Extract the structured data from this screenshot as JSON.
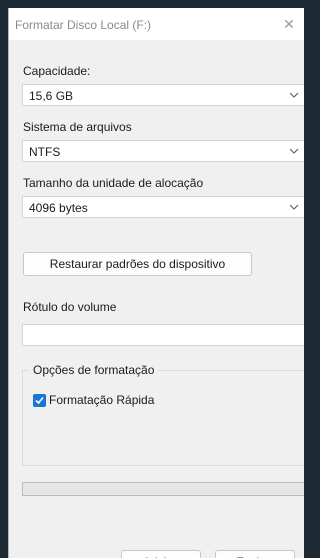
{
  "window": {
    "title": "Formatar Disco Local (F:)",
    "close_glyph": "✕"
  },
  "capacity": {
    "label": "Capacidade:",
    "value": "15,6 GB"
  },
  "filesystem": {
    "label": "Sistema de arquivos",
    "value": "NTFS"
  },
  "allocation": {
    "label": "Tamanho da unidade de alocação",
    "value": "4096 bytes"
  },
  "restore_label": "Restaurar padrões do dispositivo",
  "volume": {
    "label": "Rótulo do volume",
    "value": ""
  },
  "format_options": {
    "legend": "Opções de formatação",
    "quick_format_label": "Formatação Rápida",
    "quick_format_checked": true
  },
  "progress_fraction": 0,
  "buttons": {
    "start": "Iniciar",
    "close": "Fechar"
  },
  "colors": {
    "checkbox_accent": "#1976d2"
  }
}
